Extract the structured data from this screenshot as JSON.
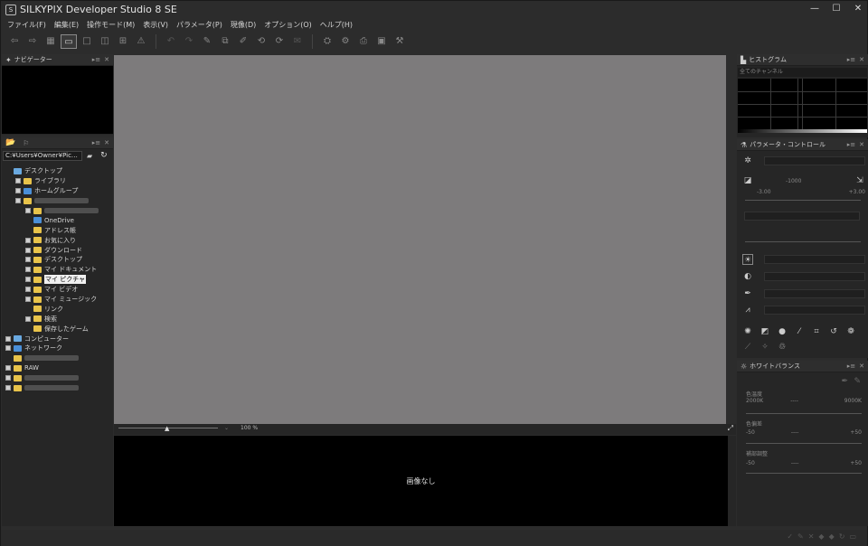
{
  "window": {
    "title": "SILKYPIX Developer Studio 8 SE",
    "app_icon": "S"
  },
  "window_controls": {
    "minimize": "—",
    "maximize": "☐",
    "close": "✕"
  },
  "menu": [
    "ファイル(F)",
    "編集(E)",
    "操作モード(M)",
    "表示(V)",
    "パラメータ(P)",
    "現像(D)",
    "オプション(O)",
    "ヘルプ(H)"
  ],
  "navigator": {
    "title": "ナビゲーター"
  },
  "folder_panel": {
    "path": "C:¥Users¥Owner¥Pic…",
    "tree": [
      {
        "label": "デスクトップ",
        "indent": 0,
        "expand": "",
        "icon": "pc"
      },
      {
        "label": "ライブラリ",
        "indent": 1,
        "expand": "+",
        "icon": "folder"
      },
      {
        "label": "ホームグループ",
        "indent": 1,
        "expand": "+",
        "icon": "blue"
      },
      {
        "label": "",
        "indent": 1,
        "expand": "−",
        "icon": "folder",
        "blurred": true
      },
      {
        "label": "",
        "indent": 2,
        "expand": "+",
        "icon": "folder",
        "blurred": true
      },
      {
        "label": "OneDrive",
        "indent": 2,
        "expand": "",
        "icon": "blue"
      },
      {
        "label": "アドレス帳",
        "indent": 2,
        "expand": "",
        "icon": "folder"
      },
      {
        "label": "お気に入り",
        "indent": 2,
        "expand": "+",
        "icon": "folder"
      },
      {
        "label": "ダウンロード",
        "indent": 2,
        "expand": "+",
        "icon": "folder"
      },
      {
        "label": "デスクトップ",
        "indent": 2,
        "expand": "+",
        "icon": "folder"
      },
      {
        "label": "マイ ドキュメント",
        "indent": 2,
        "expand": "+",
        "icon": "folder"
      },
      {
        "label": "マイ ピクチャ",
        "indent": 2,
        "expand": "+",
        "icon": "folder",
        "selected": true
      },
      {
        "label": "マイ ビデオ",
        "indent": 2,
        "expand": "+",
        "icon": "folder"
      },
      {
        "label": "マイ ミュージック",
        "indent": 2,
        "expand": "+",
        "icon": "folder"
      },
      {
        "label": "リンク",
        "indent": 2,
        "expand": "",
        "icon": "folder"
      },
      {
        "label": "検索",
        "indent": 2,
        "expand": "+",
        "icon": "folder"
      },
      {
        "label": "保存したゲーム",
        "indent": 2,
        "expand": "",
        "icon": "folder"
      },
      {
        "label": "コンピューター",
        "indent": 0,
        "expand": "+",
        "icon": "pc"
      },
      {
        "label": "ネットワーク",
        "indent": 0,
        "expand": "+",
        "icon": "blue"
      },
      {
        "label": "",
        "indent": 0,
        "expand": "",
        "icon": "folder",
        "blurred": true
      },
      {
        "label": "RAW",
        "indent": 0,
        "expand": "+",
        "icon": "folder"
      },
      {
        "label": "",
        "indent": 0,
        "expand": "+",
        "icon": "folder",
        "blurred": true
      },
      {
        "label": "",
        "indent": 0,
        "expand": "+",
        "icon": "folder",
        "blurred": true
      }
    ]
  },
  "zoom": {
    "value": "100",
    "unit": "%"
  },
  "thumbnails": {
    "empty_text": "画像なし"
  },
  "histogram": {
    "title": "ヒストグラム",
    "channel": "全てのチャンネル"
  },
  "params": {
    "title": "パラメータ・コントロール",
    "exposure_value": "-1000",
    "exposure_min": "-3.00",
    "exposure_max": "+3.00"
  },
  "white_balance": {
    "title": "ホワイトバランス",
    "color_temp_label": "色温度",
    "color_temp_min": "2000K",
    "color_temp_max": "9000K",
    "color_tint_label": "色偏差",
    "tint_min": "-50",
    "tint_max": "+50",
    "fine_label": "補部調整",
    "fine_min": "-50",
    "fine_max": "+50",
    "value_placeholder": "----"
  },
  "colors": {
    "preview": "#7d7b7c",
    "panel": "#262626",
    "window": "#2c2c2c"
  }
}
